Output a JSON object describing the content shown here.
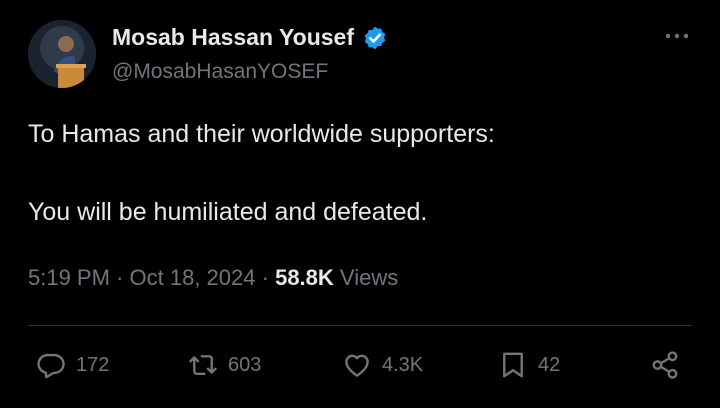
{
  "author": {
    "name": "Mosab Hassan Yousef",
    "handle": "@MosabHasanYOSEF",
    "verified_color": "#1d9bf0"
  },
  "tweet": {
    "line1": "To Hamas and their worldwide supporters:",
    "line2": "You will be humiliated and defeated.",
    "time": "5:19 PM",
    "date": "Oct 18, 2024",
    "views_count": "58.8K",
    "views_label": "Views"
  },
  "actions": {
    "replies": "172",
    "reposts": "603",
    "likes": "4.3K",
    "bookmarks": "42"
  },
  "icons": [
    "more-icon",
    "verified-badge-icon",
    "reply-icon",
    "repost-icon",
    "like-icon",
    "bookmark-icon",
    "share-icon"
  ]
}
